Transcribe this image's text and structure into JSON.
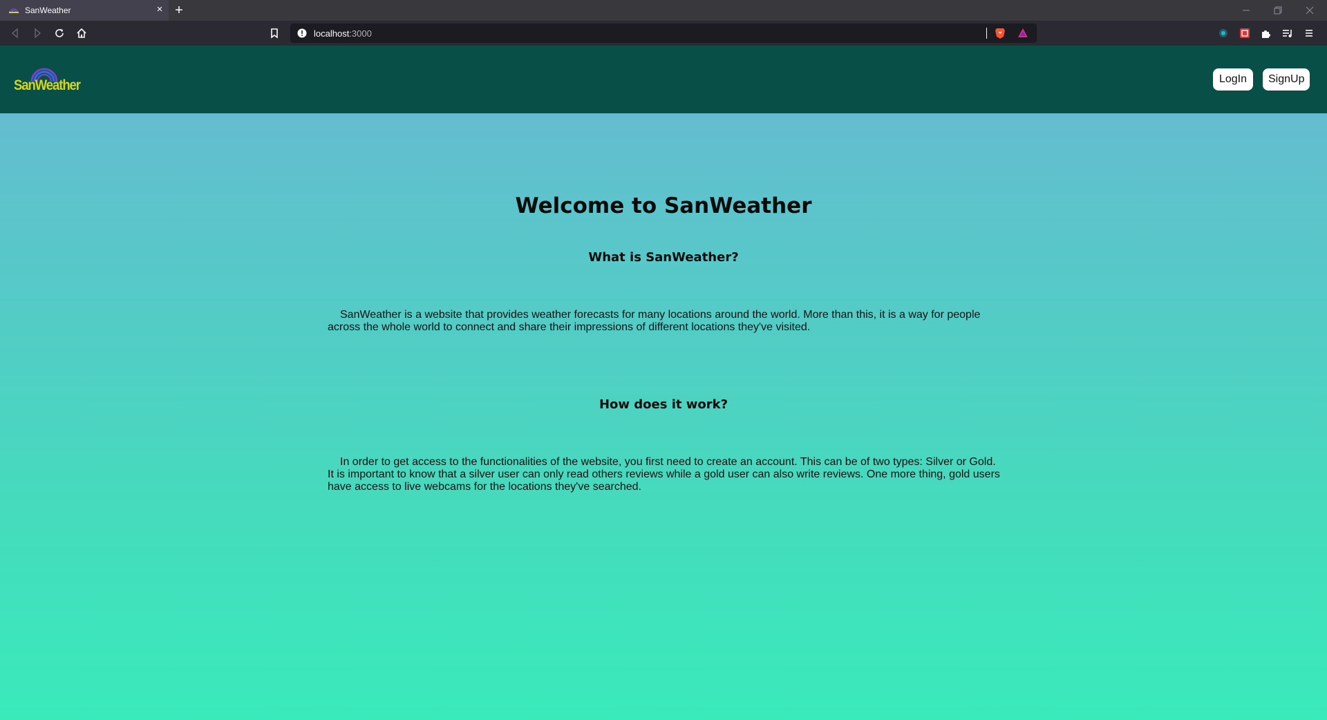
{
  "browser": {
    "tab_title": "SanWeather",
    "new_tab_icon": "+",
    "close_tab_icon": "×",
    "url_host": "localhost",
    "url_port": ":3000"
  },
  "header": {
    "logo_text": "SanWeather",
    "login_label": "LogIn",
    "signup_label": "SignUp"
  },
  "main": {
    "title": "Welcome to SanWeather",
    "section1_heading": "What is SanWeather?",
    "section1_text": "SanWeather is a website that provides weather forecasts for many locations around the world. More than this, it is a way for people across the whole world to connect and share their impressions of different locations they've visited.",
    "section2_heading": "How does it work?",
    "section2_text": "In order to get access to the functionalities of the website, you first need to create an account. This can be of two types: Silver or Gold. It is important to know that a silver user can only read others reviews while a gold user can also write reviews. One more thing, gold users have access to live webcams for the locations they've searched."
  },
  "colors": {
    "header_bg": "#074f47",
    "logo_text": "#d9d51c",
    "gradient_top": "#6ab8d2",
    "gradient_bottom": "#3aeabb"
  }
}
